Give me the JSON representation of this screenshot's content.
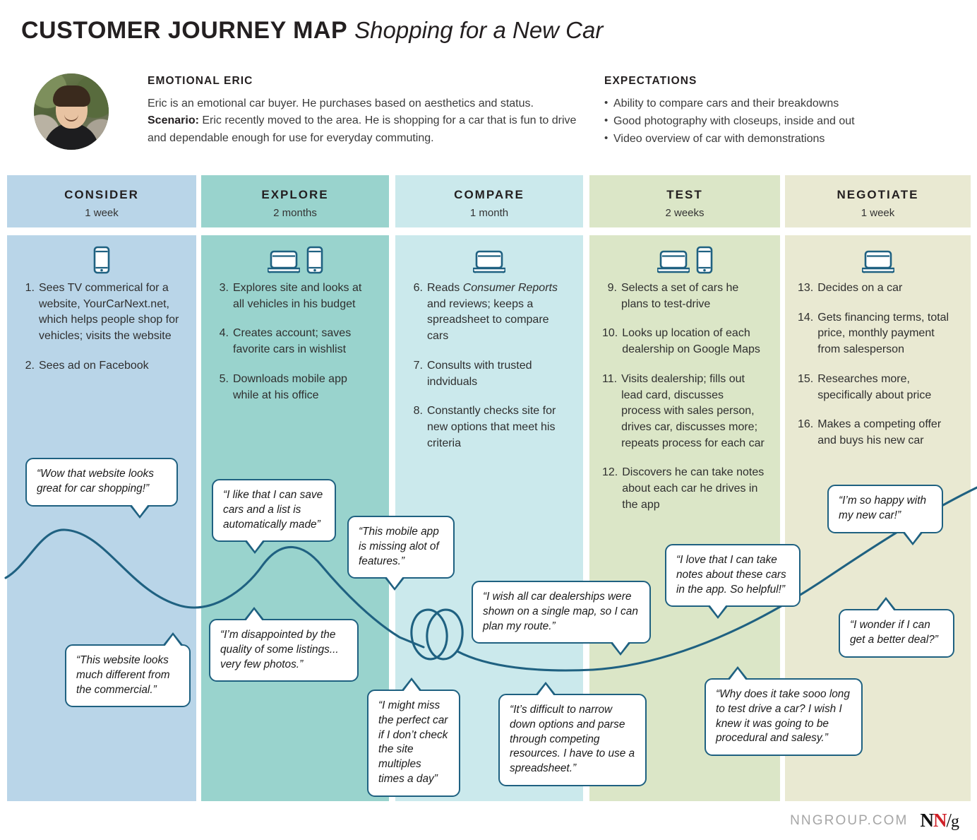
{
  "title": {
    "main": "CUSTOMER JOURNEY MAP",
    "subtitle": "Shopping for a New Car"
  },
  "persona": {
    "heading": "EMOTIONAL ERIC",
    "line1": "Eric is an emotional car buyer. He purchases based on aesthetics and status.",
    "scenario_label": "Scenario:",
    "scenario_text": " Eric recently moved to the area. He is shopping for a car that is fun to drive and dependable enough for use for everyday commuting.",
    "avatar_alt": "photo of Eric"
  },
  "expectations": {
    "heading": "EXPECTATIONS",
    "items": [
      "Ability to compare cars and their breakdowns",
      "Good photography with closeups, inside and out",
      "Video overview of car with demonstrations"
    ]
  },
  "colors": {
    "consider": "#b9d5e8",
    "explore": "#99d3cd",
    "compare": "#cbe9ec",
    "test": "#dbe6c7",
    "negotiate": "#e9e9d2",
    "line": "#1f6181",
    "bubble_border": "#1f6181",
    "accent_red": "#cf2027"
  },
  "stages": [
    {
      "name": "CONSIDER",
      "duration": "1 week",
      "devices": [
        "phone-icon"
      ],
      "actions": [
        {
          "num": "1.",
          "text": "Sees TV commerical for a website, YourCarNext.net, which helps people shop for vehicles; visits the website"
        },
        {
          "num": "2.",
          "text": "Sees ad on Facebook"
        }
      ]
    },
    {
      "name": "EXPLORE",
      "duration": "2 months",
      "devices": [
        "laptop-icon",
        "phone-icon"
      ],
      "actions": [
        {
          "num": "3.",
          "text": "Explores site and looks at all vehicles in his budget"
        },
        {
          "num": "4.",
          "text": "Creates account; saves favorite cars in wishlist"
        },
        {
          "num": "5.",
          "text": "Downloads mobile app while at his office"
        }
      ]
    },
    {
      "name": "COMPARE",
      "duration": "1 month",
      "devices": [
        "laptop-icon"
      ],
      "actions": [
        {
          "num": "6.",
          "text": "Reads Consumer Reports and reviews; keeps a spreadsheet to compare cars",
          "italic_part": "Consumer Reports"
        },
        {
          "num": "7.",
          "text": "Consults with trusted indviduals"
        },
        {
          "num": "8.",
          "text": "Constantly checks site for new options that meet his criteria"
        }
      ]
    },
    {
      "name": "TEST",
      "duration": "2 weeks",
      "devices": [
        "laptop-icon",
        "phone-icon"
      ],
      "actions": [
        {
          "num": "9.",
          "text": "Selects a set of cars he plans to test-drive"
        },
        {
          "num": "10.",
          "text": "Looks up location of each dealership on Google Maps"
        },
        {
          "num": "11.",
          "text": "Visits dealership; fills out lead card, discusses process with sales person, drives car, discusses more; repeats process for each car"
        },
        {
          "num": "12.",
          "text": "Discovers he can take notes about each car he drives in the app"
        }
      ]
    },
    {
      "name": "NEGOTIATE",
      "duration": "1 week",
      "devices": [
        "laptop-icon"
      ],
      "actions": [
        {
          "num": "13.",
          "text": "Decides on a car"
        },
        {
          "num": "14.",
          "text": "Gets financing terms, total price, monthly payment from salesperson"
        },
        {
          "num": "15.",
          "text": "Researches more, specifically about price"
        },
        {
          "num": "16.",
          "text": "Makes a competing offer and buys his new car"
        }
      ]
    }
  ],
  "quotes": [
    {
      "id": "q1",
      "stage": "CONSIDER",
      "text": "“Wow that website looks great for car shopping!”"
    },
    {
      "id": "q2",
      "stage": "CONSIDER",
      "text": "“This website looks much different from the commercial.”"
    },
    {
      "id": "q3",
      "stage": "EXPLORE",
      "text": "“I like that I can save cars and a list is automatically made”"
    },
    {
      "id": "q4",
      "stage": "EXPLORE",
      "text": "“I’m disappointed by the quality of some listings... very few photos.”"
    },
    {
      "id": "q5",
      "stage": "EXPLORE",
      "text": "“This mobile app is missing alot of features.”"
    },
    {
      "id": "q6",
      "stage": "COMPARE",
      "text": "“I might miss the perfect car if I don’t check the site multiples times a day”"
    },
    {
      "id": "q7",
      "stage": "COMPARE",
      "text": "“I wish all car dealerships were shown on a single map, so I can plan my route.”"
    },
    {
      "id": "q8",
      "stage": "COMPARE",
      "text": "“It’s difficult to narrow down options and parse through competing resources. I have to use a spreadsheet.”"
    },
    {
      "id": "q9",
      "stage": "TEST",
      "text": "“I love that I can take notes about these cars in the app. So helpful!”"
    },
    {
      "id": "q10",
      "stage": "TEST",
      "text": "“Why does it take sooo long to test drive a car? I wish I knew it was going to be procedural and salesy.”"
    },
    {
      "id": "q11",
      "stage": "NEGOTIATE",
      "text": "“I’m so happy with my new car!”"
    },
    {
      "id": "q12",
      "stage": "NEGOTIATE",
      "text": "“I wonder if I can get a better deal?”"
    }
  ],
  "footer": {
    "url": "NNGROUP.COM",
    "logo_n1": "N",
    "logo_n2": "N",
    "logo_slash": "/",
    "logo_g": "g"
  }
}
